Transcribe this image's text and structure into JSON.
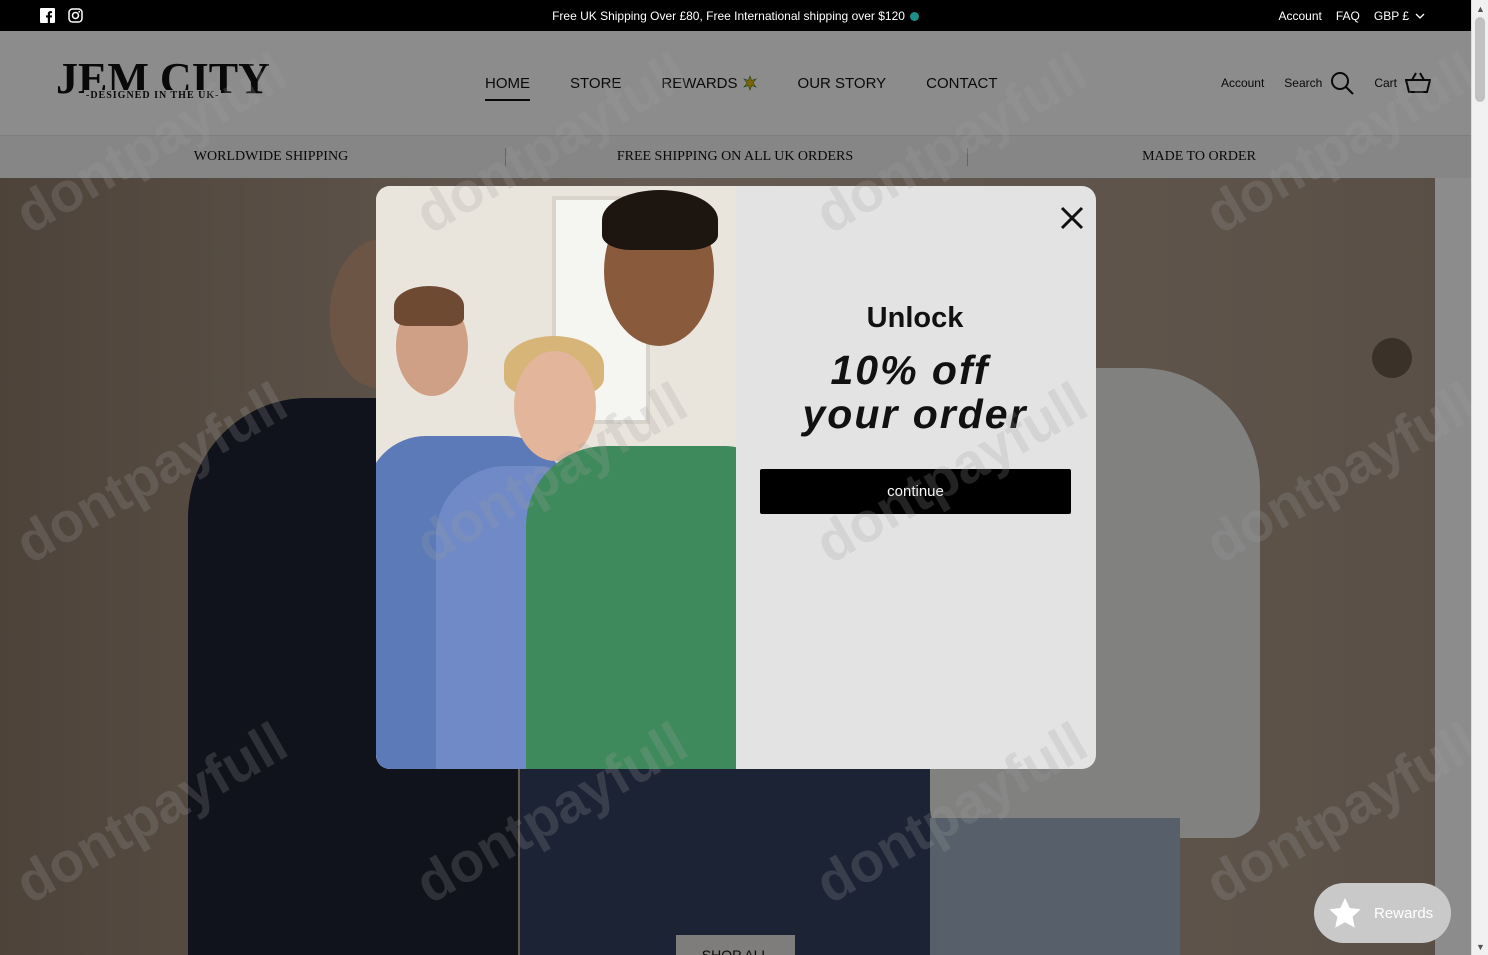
{
  "topbar": {
    "announcement": "Free UK Shipping Over £80, Free International shipping over $120",
    "links": {
      "account": "Account",
      "faq": "FAQ",
      "currency": "GBP £"
    },
    "social": [
      "facebook-icon",
      "instagram-icon"
    ]
  },
  "header": {
    "logo_main": "JEM CITY",
    "logo_sub": "-DESIGNED IN THE UK-",
    "nav": [
      "HOME",
      "STORE",
      "REWARDS",
      "OUR STORY",
      "CONTACT"
    ],
    "active_nav": "HOME",
    "account": "Account",
    "search": "Search",
    "cart": "Cart"
  },
  "usp": [
    "WORLDWIDE SHIPPING",
    "FREE SHIPPING ON ALL UK ORDERS",
    "MADE TO ORDER"
  ],
  "hero": {
    "cta": "SHOP ALL"
  },
  "popup": {
    "heading": "Unlock",
    "offer_line1": "10% off",
    "offer_line2": "your order",
    "button": "continue"
  },
  "rewards_launcher": {
    "label": "Rewards"
  },
  "watermark_text": "dontpayfull",
  "colors": {
    "topbar_bg": "#000000",
    "button_bg": "#000000",
    "popup_bg": "#e3e3e3",
    "announce_dot": "#1e8f86"
  }
}
